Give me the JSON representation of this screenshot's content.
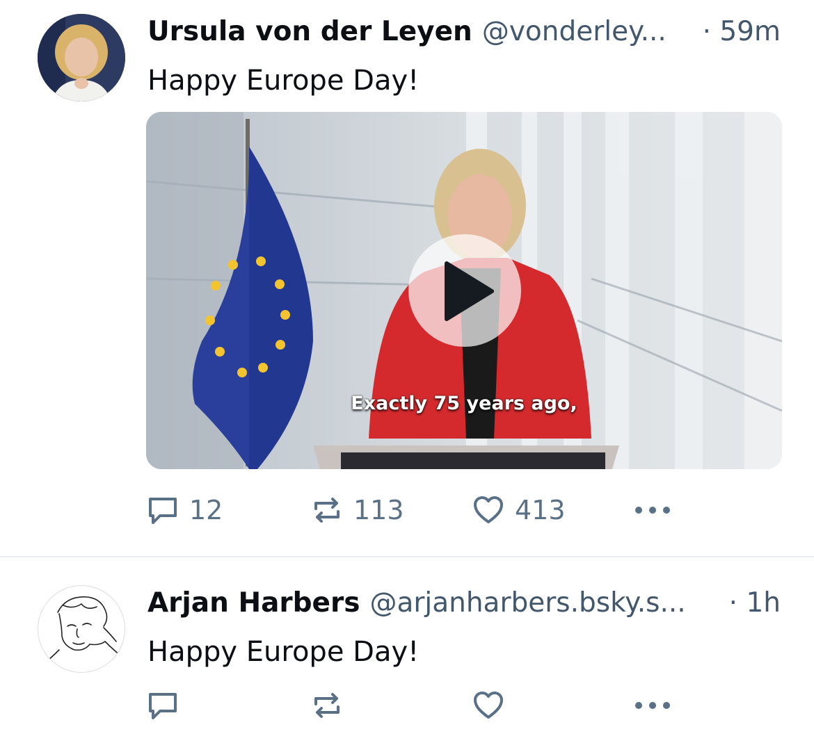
{
  "posts": [
    {
      "author_name": "Ursula von der Leyen",
      "handle": "@vonderley...",
      "time": "· 59m",
      "text": "Happy Europe Day!",
      "video_caption": "Exactly 75 years ago,",
      "replies": "12",
      "reposts": "113",
      "likes": "413",
      "avatar_icon": "profile-photo-woman",
      "media_icon": "play-icon"
    },
    {
      "author_name": "Arjan Harbers",
      "handle": "@arjanharbers.bsky.s...",
      "time": "· 1h",
      "text": "Happy Europe Day!",
      "avatar_icon": "line-drawing-portrait"
    }
  ],
  "colors": {
    "text": "#0b0f14",
    "muted": "#42576c",
    "icon": "#5a7086",
    "divider": "#e6e9ee",
    "flag_blue": "#22378f",
    "flag_star": "#f4c430",
    "jacket_red": "#d42a2e"
  }
}
